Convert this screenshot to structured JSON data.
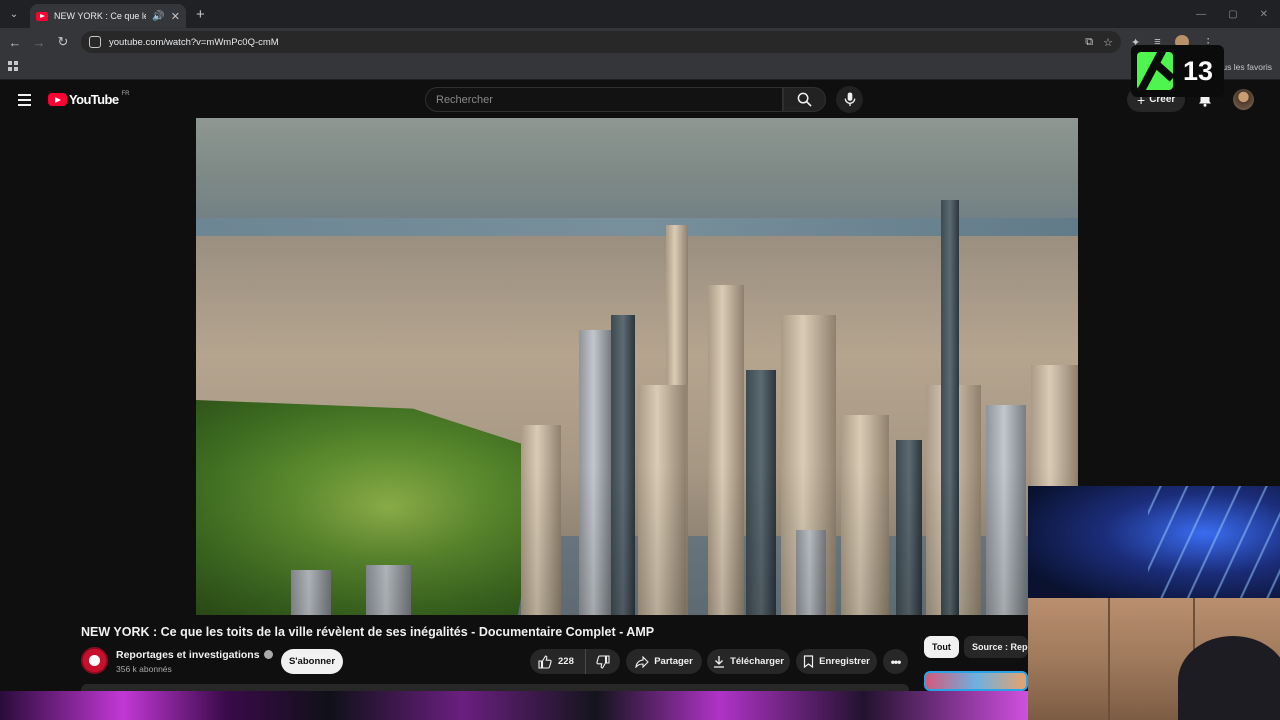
{
  "browser": {
    "tab_title": "NEW YORK : Ce que les toit",
    "url": "youtube.com/watch?v=mWmPc0Q-cmM",
    "bookmarks_all_label": "Tous les favoris"
  },
  "masthead": {
    "country_code": "FR",
    "search_placeholder": "Rechercher",
    "create_label": "Créer"
  },
  "overlay": {
    "channel_number": "13"
  },
  "video": {
    "title": "NEW YORK : Ce que les toits de la ville révèlent de ses inégalités - Documentaire Complet - AMP",
    "channel_name": "Reportages et investigations",
    "subscribers": "356 k abonnés",
    "subscribe_label": "S'abonner",
    "likes": "228",
    "share_label": "Partager",
    "download_label": "Télécharger",
    "save_label": "Enregistrer"
  },
  "chips": {
    "all": "Tout",
    "source": "Source : Repo"
  },
  "colors": {
    "brand_red": "#ff0033",
    "k13_green": "#4ff54f",
    "background": "#0f0f0f"
  }
}
